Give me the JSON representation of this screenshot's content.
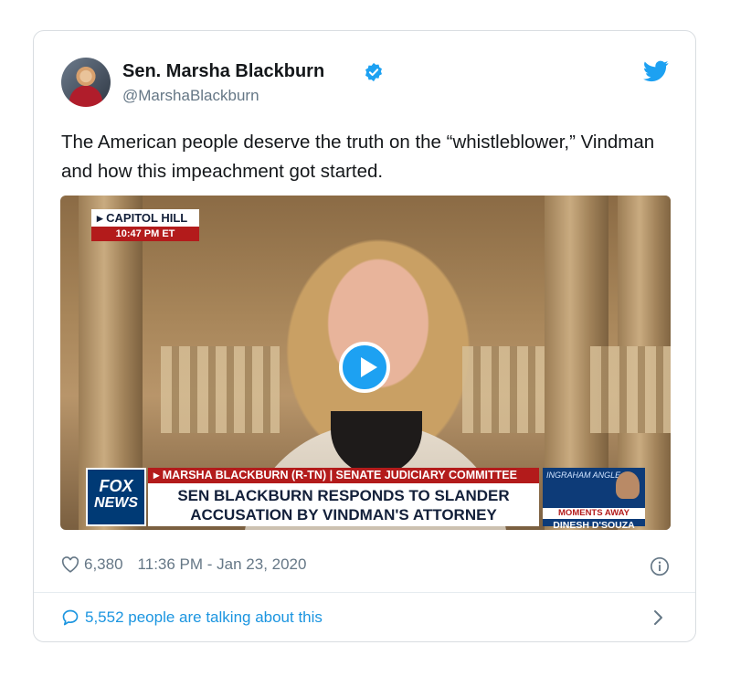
{
  "tweet": {
    "author_name": "Sen. Marsha Blackburn",
    "handle": "@MarshaBlackburn",
    "text": "The American people deserve the truth on the “whistleblower,” Vindman and how this impeachment got started.",
    "likes": "6,380",
    "timestamp": "11:36 PM - Jan 23, 2020",
    "talking_about": "5,552 people are talking about this"
  },
  "video": {
    "location": "▸ CAPITOL HILL",
    "time": "10:47 PM ET",
    "network_line1": "FOX",
    "network_line2": "NEWS",
    "banner_top": "▸ MARSHA BLACKBURN (R-TN) | SENATE JUDICIARY COMMITTEE",
    "headline": "SEN BLACKBURN RESPONDS TO SLANDER ACCUSATION BY VINDMAN'S ATTORNEY",
    "promo_show": "INGRAHAM ANGLE",
    "promo_soon": "MOMENTS AWAY",
    "promo_guest": "DINESH D'SOUZA"
  },
  "icons": {
    "verified": "verified-badge-icon",
    "twitter": "twitter-bird-icon",
    "play": "play-icon",
    "heart": "heart-icon",
    "info": "info-icon",
    "comment": "comment-bubble-icon",
    "chevron": "chevron-right-icon"
  },
  "colors": {
    "brand_blue": "#1da1f2",
    "link_blue": "#1b95e0",
    "muted": "#657786",
    "fox_red": "#b31b1b"
  }
}
